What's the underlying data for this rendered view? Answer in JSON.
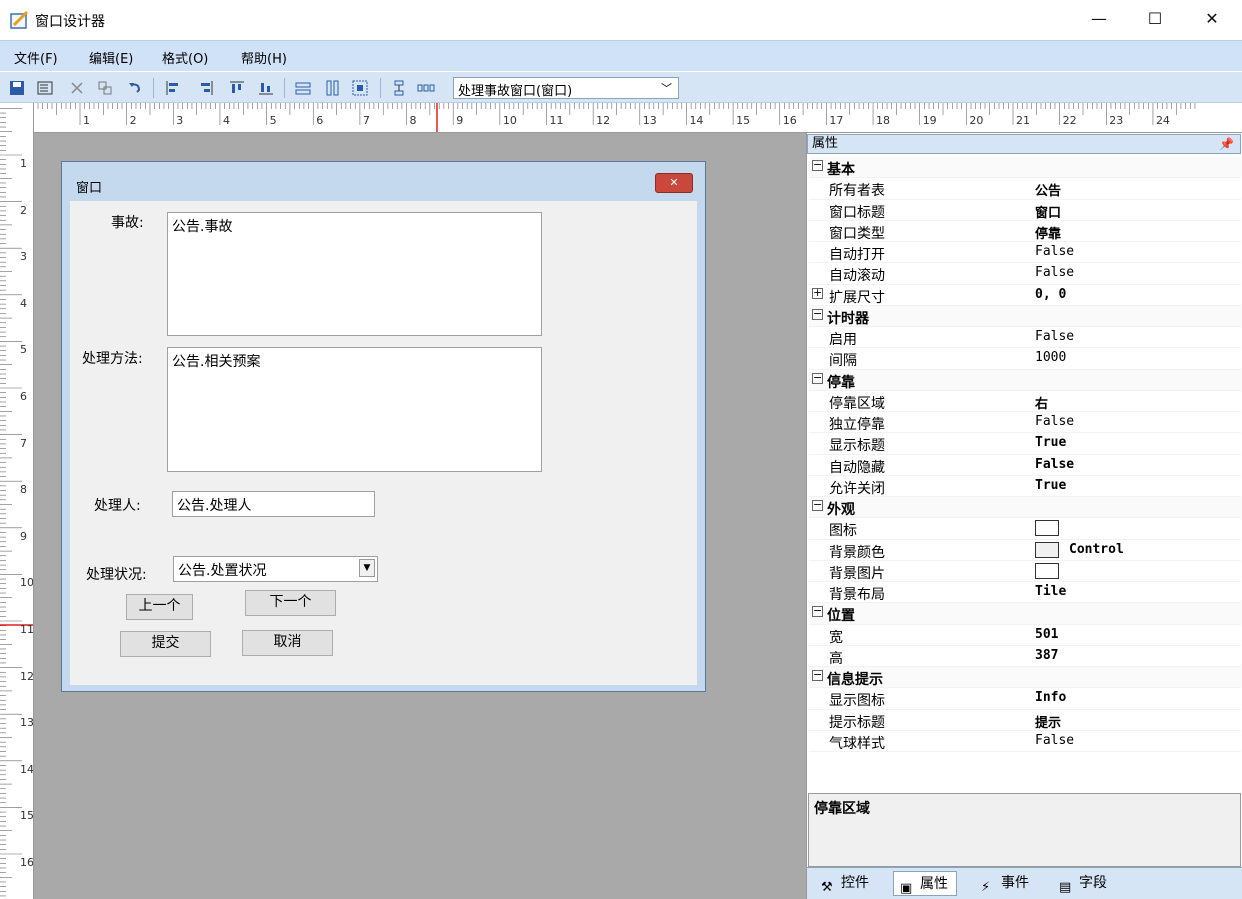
{
  "window": {
    "title": "窗口设计器",
    "minimize": "—",
    "maximize": "☐",
    "close": "✕"
  },
  "menu": [
    "文件(F)",
    "编辑(E)",
    "格式(O)",
    "帮助(H)"
  ],
  "toolbar": {
    "combo_value": "处理事故窗口(窗口)"
  },
  "ruler": {
    "h": [
      "1",
      "2",
      "3",
      "4",
      "5",
      "6",
      "7",
      "8",
      "9",
      "10",
      "11",
      "12",
      "13",
      "14",
      "15",
      "16",
      "17",
      "18",
      "19",
      "20",
      "21",
      "22",
      "23",
      "24"
    ],
    "v": [
      "1",
      "2",
      "3",
      "4",
      "5",
      "6",
      "7",
      "8",
      "9",
      "10",
      "11",
      "12",
      "13",
      "14",
      "15",
      "16"
    ]
  },
  "design": {
    "title": "窗口",
    "labels": {
      "incident": "事故:",
      "method": "处理方法:",
      "handler": "处理人:",
      "status": "处理状况:"
    },
    "values": {
      "incident": "公告.事故",
      "method": "公告.相关预案",
      "handler": "公告.处理人",
      "status": "公告.处置状况"
    },
    "buttons": {
      "prev": "上一个",
      "next": "下一个",
      "submit": "提交",
      "cancel": "取消"
    }
  },
  "props": {
    "header": "属性",
    "rows": [
      {
        "t": "cat",
        "exp": "⊟",
        "name": "基本"
      },
      {
        "t": "p",
        "name": "所有者表",
        "val": "公告",
        "bold": true
      },
      {
        "t": "p",
        "name": "窗口标题",
        "val": "窗口",
        "bold": true
      },
      {
        "t": "p",
        "name": "窗口类型",
        "val": "停靠",
        "bold": true
      },
      {
        "t": "p",
        "name": "自动打开",
        "val": "False"
      },
      {
        "t": "p",
        "name": "自动滚动",
        "val": "False"
      },
      {
        "t": "p",
        "exp": "⊞",
        "name": "扩展尺寸",
        "val": "0, 0",
        "bold": true
      },
      {
        "t": "cat",
        "exp": "⊟",
        "name": "计时器"
      },
      {
        "t": "p",
        "name": "启用",
        "val": "False"
      },
      {
        "t": "p",
        "name": "间隔",
        "val": "1000"
      },
      {
        "t": "cat",
        "exp": "⊟",
        "name": "停靠"
      },
      {
        "t": "p",
        "name": "停靠区域",
        "val": "右",
        "bold": true
      },
      {
        "t": "p",
        "name": "独立停靠",
        "val": "False"
      },
      {
        "t": "p",
        "name": "显示标题",
        "val": "True",
        "bold": true
      },
      {
        "t": "p",
        "name": "自动隐藏",
        "val": "False",
        "bold": true
      },
      {
        "t": "p",
        "name": "允许关闭",
        "val": "True",
        "bold": true
      },
      {
        "t": "cat",
        "exp": "⊟",
        "name": "外观"
      },
      {
        "t": "sw",
        "name": "图标"
      },
      {
        "t": "sw",
        "name": "背景颜色",
        "ctl": true,
        "val": "Control"
      },
      {
        "t": "sw",
        "name": "背景图片"
      },
      {
        "t": "p",
        "name": "背景布局",
        "val": "Tile",
        "bold": true
      },
      {
        "t": "cat",
        "exp": "⊟",
        "name": "位置"
      },
      {
        "t": "p",
        "name": "宽",
        "val": "501",
        "bold": true
      },
      {
        "t": "p",
        "name": "高",
        "val": "387",
        "bold": true
      },
      {
        "t": "cat",
        "exp": "⊟",
        "name": "信息提示"
      },
      {
        "t": "p",
        "name": "显示图标",
        "val": "Info",
        "bold": true
      },
      {
        "t": "p",
        "name": "提示标题",
        "val": "提示",
        "bold": true
      },
      {
        "t": "p",
        "name": "气球样式",
        "val": "False"
      }
    ],
    "desc_title": "停靠区域",
    "tabs": [
      {
        "label": "控件",
        "icon": "⚒"
      },
      {
        "label": "属性",
        "icon": "▣"
      },
      {
        "label": "事件",
        "icon": "⚡"
      },
      {
        "label": "字段",
        "icon": "▤"
      }
    ]
  }
}
